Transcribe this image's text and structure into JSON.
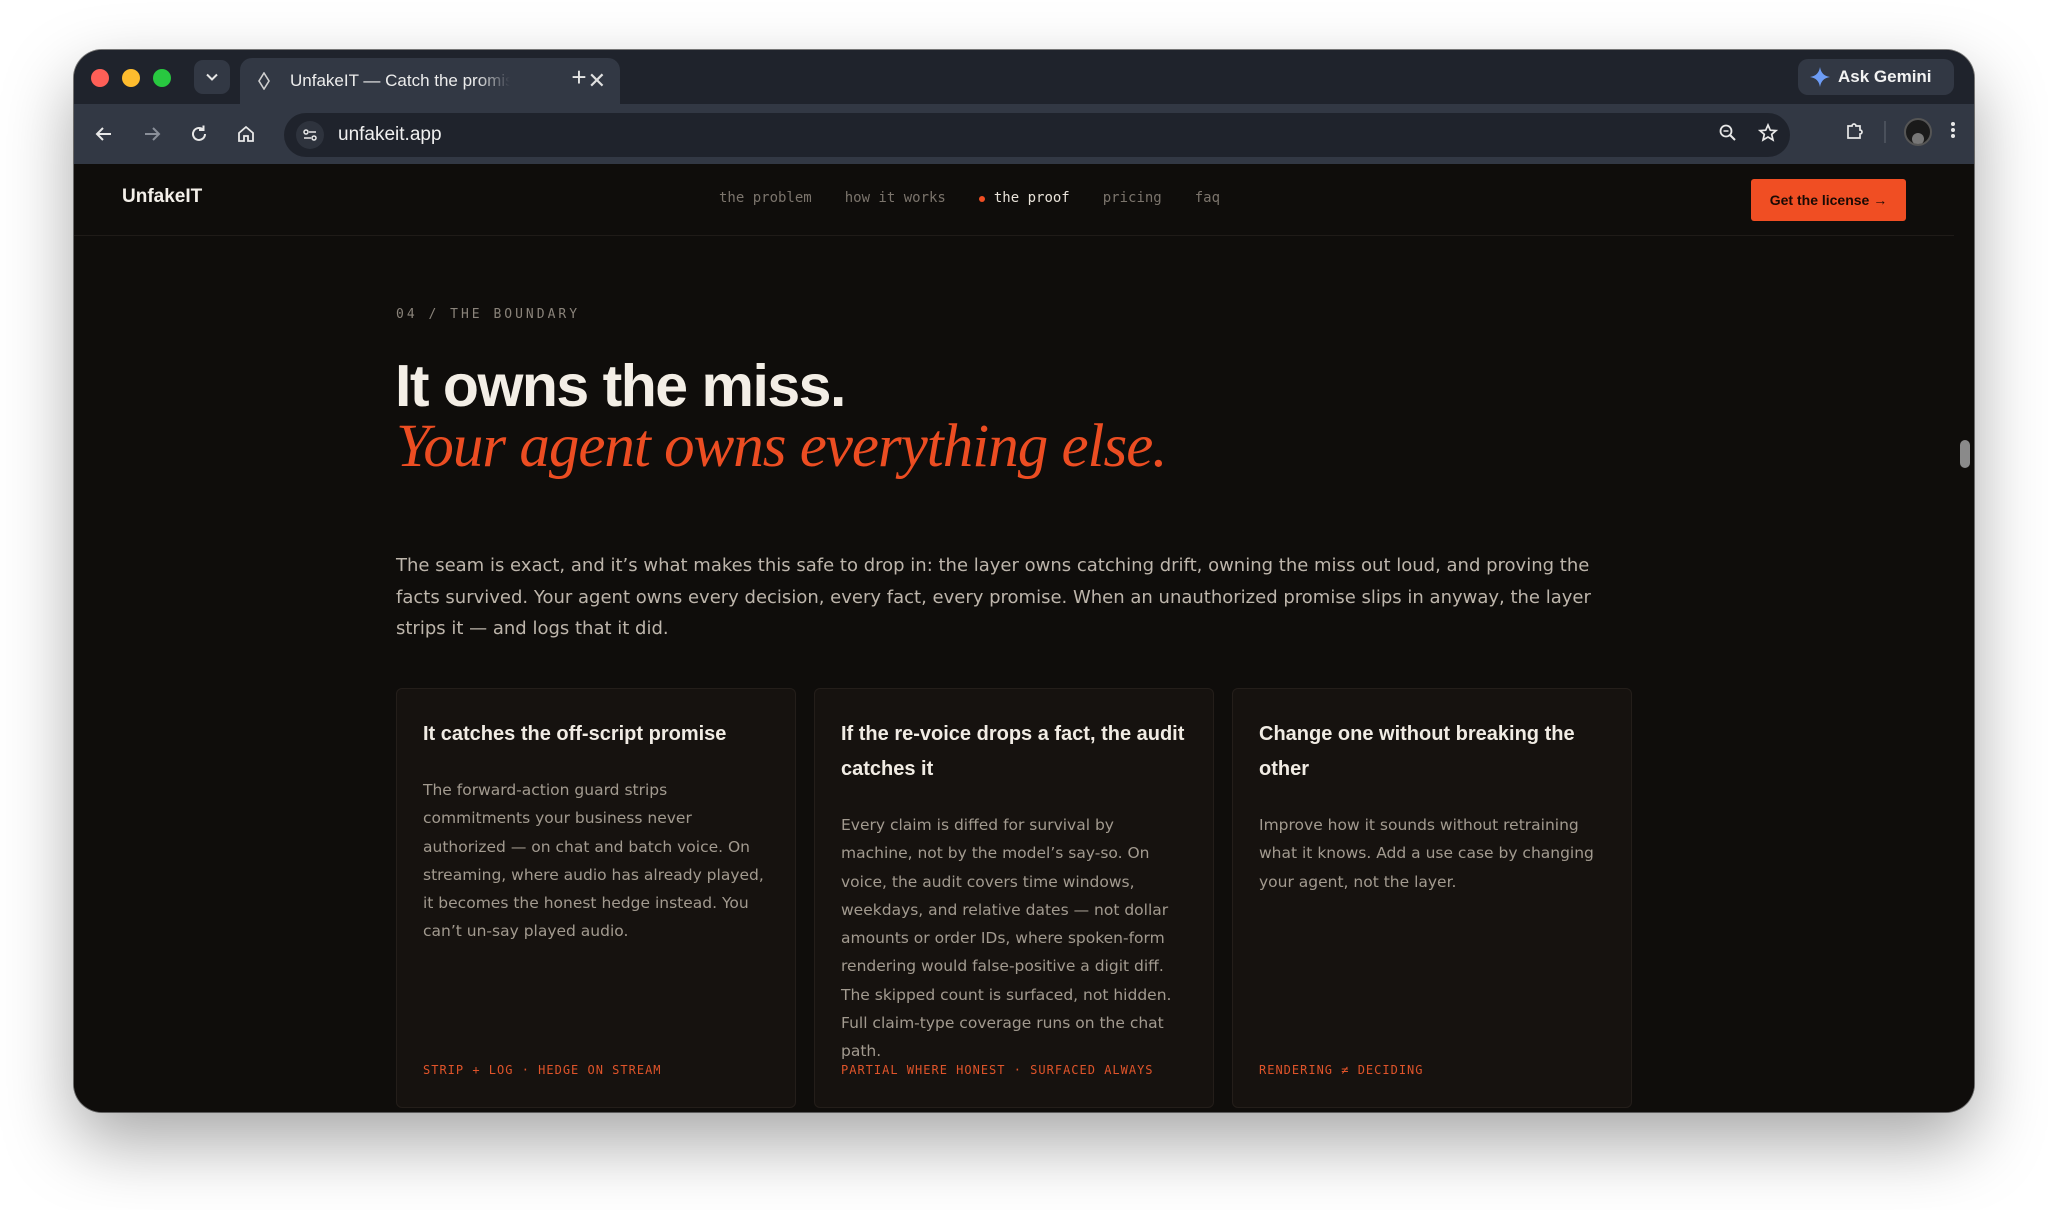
{
  "browser": {
    "tab_title": "UnfakeIT — Catch the promise",
    "close_glyph": "✕",
    "new_tab_glyph": "+",
    "ask_gemini_label": "Ask Gemini",
    "url": "unfakeit.app"
  },
  "site": {
    "logo": "UnfakeIT",
    "nav": [
      "the problem",
      "how it works",
      "the proof",
      "pricing",
      "faq"
    ],
    "active_nav": "the proof",
    "cta_label": "Get the license →"
  },
  "section": {
    "eyebrow": "04 / THE BOUNDARY",
    "headline": "It owns the miss.",
    "headline_italic": "Your agent owns everything else.",
    "lead": "The seam is exact, and it’s what makes this safe to drop in: the layer owns catching drift, owning the miss out loud, and proving the facts survived. Your agent owns every decision, every fact, every promise. When an unauthorized promise slips in anyway, the layer strips it — and logs that it did."
  },
  "cards": [
    {
      "title": "It catches the off-script promise",
      "body": "The forward-action guard strips commitments your business never authorized — on chat and batch voice. On streaming, where audio has already played, it becomes the honest hedge instead. You can’t un-say played audio.",
      "tag": "STRIP + LOG · HEDGE ON STREAM"
    },
    {
      "title": "If the re-voice drops a fact, the audit catches it",
      "body": "Every claim is diffed for survival by machine, not by the model’s say-so. On voice, the audit covers time windows, weekdays, and relative dates — not dollar amounts or order IDs, where spoken-form rendering would false-positive a digit diff. The skipped count is surfaced, not hidden. Full claim-type coverage runs on the chat path.",
      "tag": "PARTIAL WHERE HONEST · SURFACED ALWAYS"
    },
    {
      "title": "Change one without breaking the other",
      "body": "Improve how it sounds without retraining what it knows. Add a use case by changing your agent, not the layer.",
      "tag": "RENDERING ≠ DECIDING"
    }
  ],
  "colors": {
    "accent": "#f04e23",
    "page_bg": "#0f0d0b",
    "card_bg": "#16120f"
  }
}
